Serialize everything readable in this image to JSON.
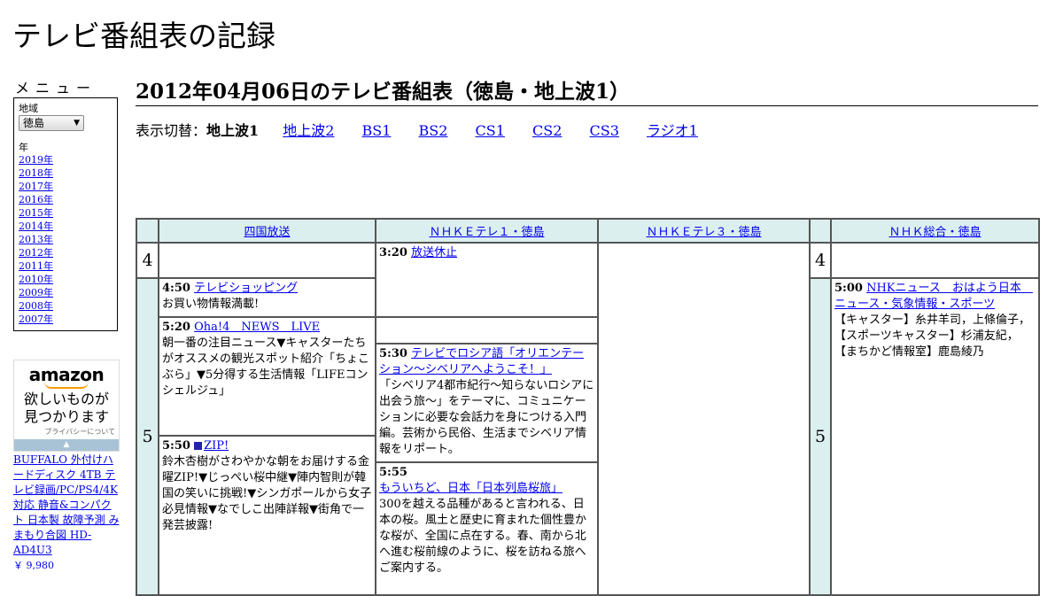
{
  "site_title": "テレビ番組表の記録",
  "menu": {
    "label": "メニュー",
    "region_label": "地域",
    "region_value": "徳島",
    "year_label": "年",
    "years": [
      "2019年",
      "2018年",
      "2017年",
      "2016年",
      "2015年",
      "2014年",
      "2013年",
      "2012年",
      "2011年",
      "2010年",
      "2009年",
      "2008年",
      "2007年"
    ]
  },
  "ad": {
    "logo": "amazon",
    "copy_line1": "欲しいものが",
    "copy_line2": "見つかります",
    "privacy": "プライバシーについて",
    "product_title": "BUFFALO 外付けハードディスク 4TB テレビ録画/PC/PS4/4K対応 静音&コンパクト 日本製 故障予測 みまもり合図 HD-AD4U3",
    "price": "￥ 9,980"
  },
  "page_title": "2012年04月06日のテレビ番組表（徳島・地上波1）",
  "switcher": {
    "label": "表示切替：",
    "current": "地上波1",
    "links": [
      "地上波2",
      "BS1",
      "BS2",
      "CS1",
      "CS2",
      "CS3",
      "ラジオ1"
    ]
  },
  "channels": [
    "四国放送",
    "ＮＨＫＥテレ１・徳島",
    "ＮＨＫＥテレ３・徳島",
    "ＮＨＫ総合・徳島"
  ],
  "hours": [
    "4",
    "5"
  ],
  "programs": {
    "p1": {
      "time": "4:50",
      "title": "テレビショッピング",
      "desc": "お買い物情報満載!"
    },
    "p2": {
      "time": "5:20",
      "title": "Oha!4　NEWS　LIVE",
      "desc": "朝一番の注目ニュース▼キャスターたちがオススメの観光スポット紹介「ちょこぶら」▼5分得する生活情報「LIFEコンシェルジュ」"
    },
    "p3": {
      "time": "5:50",
      "title": "ZIP!",
      "desc": "鈴木杏樹がさわやかな朝をお届けする金曜ZIP!▼じっぺい桜中継▼陣内智則が韓国の笑いに挑戦!▼シンガポールから女子必見情報▼なでしこ出陣詳報▼街角で一発芸披露!"
    },
    "e1": {
      "time": "3:20",
      "title": "放送休止",
      "desc": ""
    },
    "e2": {
      "time": "5:30",
      "title": "テレビでロシア語「オリエンテーション～シベリアへようこそ！」",
      "desc": "「シベリア4都市紀行～知らないロシアに出会う旅～」をテーマに、コミュニケーションに必要な会話力を身につける入門編。芸術から民俗、生活までシベリア情報をリポート。"
    },
    "e3": {
      "time": "5:55",
      "title": "もういちど、日本「日本列島桜旅」",
      "desc": "300を越える品種があると言われる、日本の桜。風土と歴史に育まれた個性豊かな桜が、全国に点在する。春、南から北へ進む桜前線のように、桜を訪ねる旅へご案内する。"
    },
    "n1": {
      "time": "5:00",
      "title": "NHKニュース　おはよう日本　ニュース・気象情報・スポーツ",
      "desc": "【キャスター】糸井羊司，上條倫子，【スポーツキャスター】杉浦友紀，【まちかど情報室】鹿島綾乃"
    }
  },
  "colors": {
    "header_bg": "#dcefef",
    "link": "#0000ee",
    "border": "#555555"
  }
}
